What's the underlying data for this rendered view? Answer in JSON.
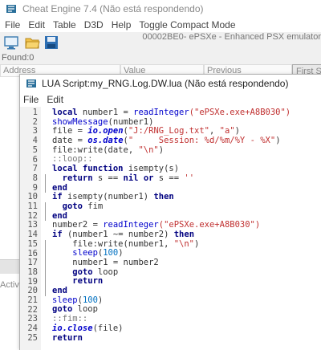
{
  "main": {
    "title": "Cheat Engine 7.4 (Não está respondendo)",
    "menu": [
      "File",
      "Edit",
      "Table",
      "D3D",
      "Help",
      "Toggle Compact Mode"
    ],
    "process": "00002BE0- ePSXe - Enhanced PSX emulator",
    "found": "Found:0",
    "columns": [
      "Address",
      "Value",
      "Previous"
    ],
    "first_scan": "First Scan",
    "acti": "Activ"
  },
  "lua": {
    "title": "LUA Script:my_RNG.Log.DW.lua (Não está respondendo)",
    "menu": [
      "File",
      "Edit"
    ],
    "line_numbers": [
      "1",
      "2",
      "3",
      "4",
      "5",
      "6",
      "7",
      "8",
      "9",
      "10",
      "11",
      "12",
      "13",
      "14",
      "15",
      "16",
      "17",
      "18",
      "19",
      "20",
      "21",
      "22",
      "23",
      "24",
      "25"
    ],
    "lines": [
      [
        {
          "t": "local",
          "c": "kw"
        },
        {
          "t": " number1 = ",
          "c": "plain"
        },
        {
          "t": "readInteger",
          "c": "fn"
        },
        {
          "t": "(\"ePSXe.exe+A8B030\")",
          "c": "str"
        }
      ],
      [
        {
          "t": "showMessage",
          "c": "fn"
        },
        {
          "t": "(number1)",
          "c": "plain"
        }
      ],
      [
        {
          "t": "file = ",
          "c": "plain"
        },
        {
          "t": "io.open",
          "c": "fni"
        },
        {
          "t": "(",
          "c": "plain"
        },
        {
          "t": "\"J:/RNG_Log.txt\"",
          "c": "str"
        },
        {
          "t": ", ",
          "c": "plain"
        },
        {
          "t": "\"a\"",
          "c": "str"
        },
        {
          "t": ")",
          "c": "plain"
        }
      ],
      [
        {
          "t": "date = ",
          "c": "plain"
        },
        {
          "t": "os.date",
          "c": "fni"
        },
        {
          "t": "(",
          "c": "plain"
        },
        {
          "t": "\"     Session: %d/%m/%Y - %X\"",
          "c": "str"
        },
        {
          "t": ")",
          "c": "plain"
        }
      ],
      [
        {
          "t": "file:write(date, ",
          "c": "plain"
        },
        {
          "t": "\"\\n\"",
          "c": "str"
        },
        {
          "t": ")",
          "c": "plain"
        }
      ],
      [
        {
          "t": "::loop::",
          "c": "sym"
        }
      ],
      [
        {
          "t": "local function",
          "c": "kw"
        },
        {
          "t": " isempty(s)",
          "c": "plain"
        }
      ],
      [
        {
          "t": "  return",
          "c": "kw"
        },
        {
          "t": " s == ",
          "c": "plain"
        },
        {
          "t": "nil",
          "c": "kw"
        },
        {
          "t": " ",
          "c": "plain"
        },
        {
          "t": "or",
          "c": "kw"
        },
        {
          "t": " s == ",
          "c": "plain"
        },
        {
          "t": "''",
          "c": "str"
        }
      ],
      [
        {
          "t": "end",
          "c": "kw"
        }
      ],
      [
        {
          "t": "if",
          "c": "kw"
        },
        {
          "t": " isempty(number1) ",
          "c": "plain"
        },
        {
          "t": "then",
          "c": "kw"
        }
      ],
      [
        {
          "t": "  goto",
          "c": "kw"
        },
        {
          "t": " fim",
          "c": "plain"
        }
      ],
      [
        {
          "t": "end",
          "c": "kw"
        }
      ],
      [
        {
          "t": "number2 = ",
          "c": "plain"
        },
        {
          "t": "readInteger",
          "c": "fn"
        },
        {
          "t": "(\"ePSXe.exe+A8B030\")",
          "c": "str"
        }
      ],
      [
        {
          "t": "if",
          "c": "kw"
        },
        {
          "t": " (number1 ~= number2) ",
          "c": "plain"
        },
        {
          "t": "then",
          "c": "kw"
        }
      ],
      [
        {
          "t": "    file:write(number1, ",
          "c": "plain"
        },
        {
          "t": "\"\\n\"",
          "c": "str"
        },
        {
          "t": ")",
          "c": "plain"
        }
      ],
      [
        {
          "t": "    ",
          "c": "plain"
        },
        {
          "t": "sleep",
          "c": "fn"
        },
        {
          "t": "(",
          "c": "plain"
        },
        {
          "t": "100",
          "c": "num"
        },
        {
          "t": ")",
          "c": "plain"
        }
      ],
      [
        {
          "t": "    number1 = number2",
          "c": "plain"
        }
      ],
      [
        {
          "t": "    goto",
          "c": "kw"
        },
        {
          "t": " loop",
          "c": "plain"
        }
      ],
      [
        {
          "t": "    return",
          "c": "kw"
        }
      ],
      [
        {
          "t": "end",
          "c": "kw"
        }
      ],
      [
        {
          "t": "sleep",
          "c": "fn"
        },
        {
          "t": "(",
          "c": "plain"
        },
        {
          "t": "100",
          "c": "num"
        },
        {
          "t": ")",
          "c": "plain"
        }
      ],
      [
        {
          "t": "goto",
          "c": "kw"
        },
        {
          "t": " loop",
          "c": "plain"
        }
      ],
      [
        {
          "t": "::fim::",
          "c": "sym"
        }
      ],
      [
        {
          "t": "io.close",
          "c": "fni"
        },
        {
          "t": "(file)",
          "c": "plain"
        }
      ],
      [
        {
          "t": "return",
          "c": "kw"
        }
      ]
    ]
  },
  "colors": {
    "keyword": "#000080",
    "function": "#0000cc",
    "string": "#c03030",
    "number": "#0070c0",
    "gutter": "#f2f2f2"
  },
  "icons": [
    "cheat-engine-logo-icon",
    "open-process-icon",
    "open-file-icon",
    "save-icon"
  ]
}
